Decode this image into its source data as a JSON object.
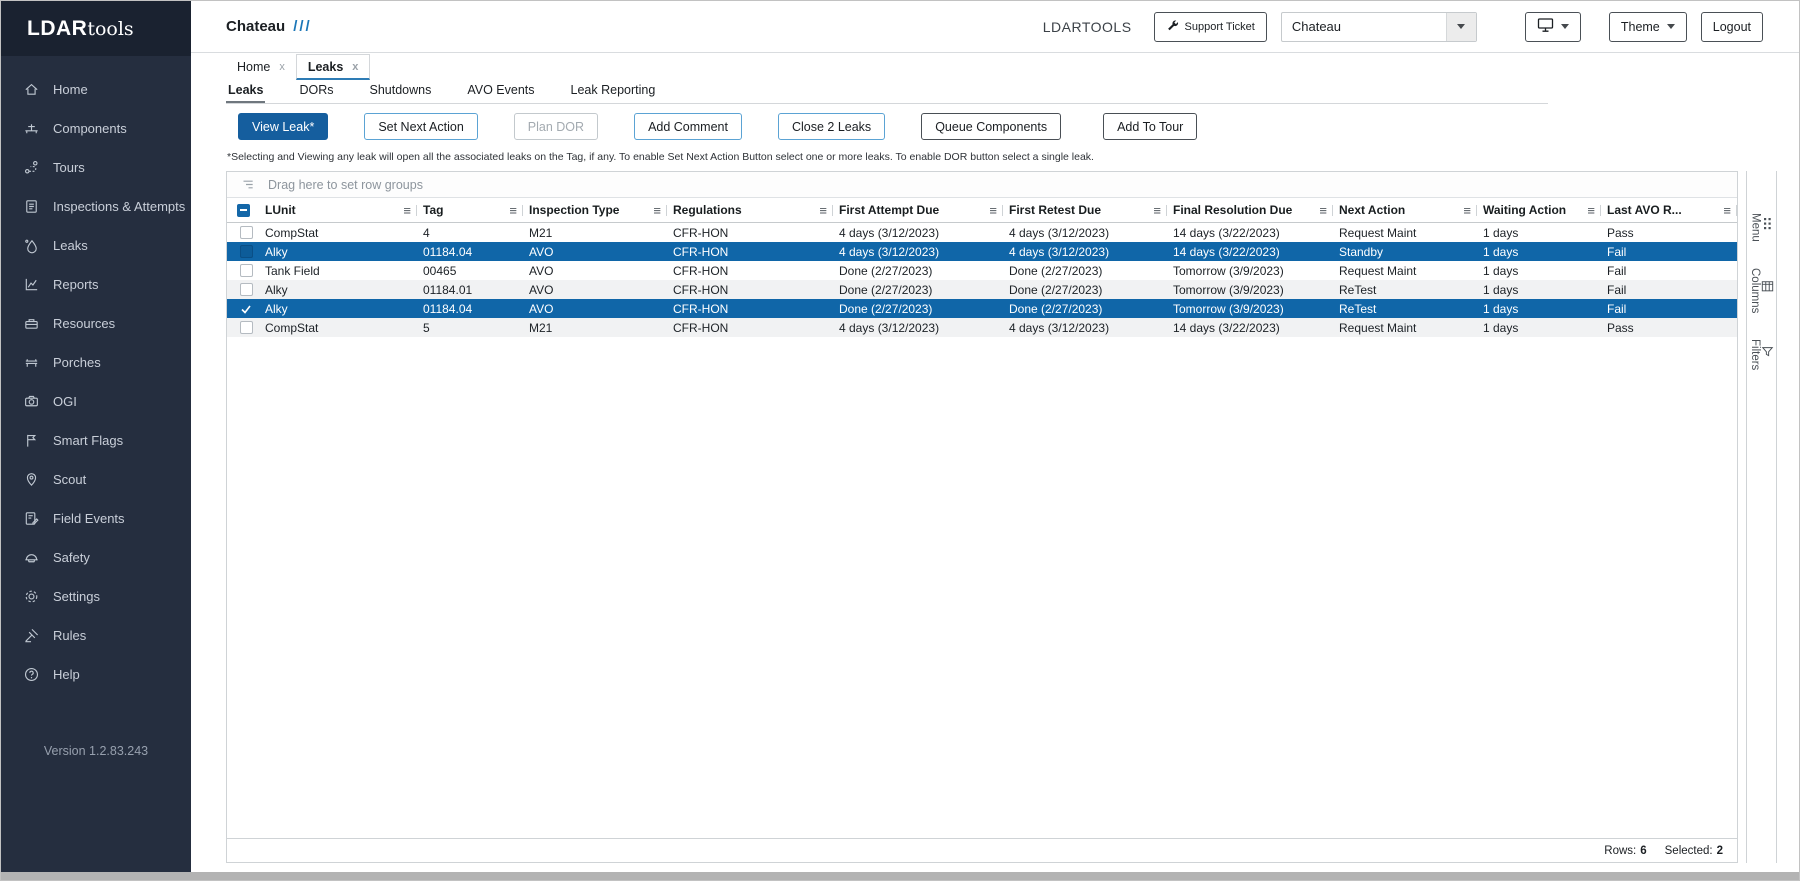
{
  "colors": {
    "accent_blue": "#1066a8",
    "primary_button_blue": "#155e9e",
    "sidebar_bg": "#252e3f",
    "sidebar_logo_bg": "#1a2230",
    "selected_row_blue": "#1066a8",
    "tab_underline_blue": "#2e7cb5"
  },
  "sidebar": {
    "logo": {
      "bold": "LDAR",
      "light": "tools"
    },
    "version": "Version 1.2.83.243",
    "items": [
      {
        "label": "Home",
        "icon": "home-icon"
      },
      {
        "label": "Components",
        "icon": "valve-icon"
      },
      {
        "label": "Tours",
        "icon": "route-icon"
      },
      {
        "label": "Inspections & Attempts",
        "icon": "clipboard-icon"
      },
      {
        "label": "Leaks",
        "icon": "droplet-icon"
      },
      {
        "label": "Reports",
        "icon": "chart-icon"
      },
      {
        "label": "Resources",
        "icon": "toolbox-icon"
      },
      {
        "label": "Porches",
        "icon": "bench-icon"
      },
      {
        "label": "OGI",
        "icon": "camera-icon"
      },
      {
        "label": "Smart Flags",
        "icon": "flag-icon"
      },
      {
        "label": "Scout",
        "icon": "map-pin-icon"
      },
      {
        "label": "Field Events",
        "icon": "clipboard-pen-icon"
      },
      {
        "label": "Safety",
        "icon": "helmet-icon"
      },
      {
        "label": "Settings",
        "icon": "gear-icon"
      },
      {
        "label": "Rules",
        "icon": "gavel-icon"
      },
      {
        "label": "Help",
        "icon": "question-icon"
      }
    ]
  },
  "header": {
    "title": "Chateau",
    "slashes": "///",
    "brand": "LDARTOOLS",
    "support_ticket": "Support Ticket",
    "site_selector_value": "Chateau",
    "theme": "Theme",
    "logout": "Logout"
  },
  "tabs": {
    "items": [
      {
        "label": "Home",
        "close": "x",
        "active": false
      },
      {
        "label": "Leaks",
        "close": "x",
        "active": true
      }
    ]
  },
  "subtabs": {
    "items": [
      "Leaks",
      "DORs",
      "Shutdowns",
      "AVO Events",
      "Leak Reporting"
    ]
  },
  "toolbar": {
    "view_leak": "View Leak*",
    "set_next_action": "Set Next Action",
    "plan_dor": "Plan DOR",
    "add_comment": "Add Comment",
    "close_leaks": "Close 2 Leaks",
    "queue_components": "Queue Components",
    "add_to_tour": "Add To Tour"
  },
  "note": "*Selecting and Viewing any leak will open all the associated leaks on the Tag, if any.  To enable Set Next Action Button select one or more leaks. To enable DOR button select a single leak.",
  "grid": {
    "row_group_hint": "Drag here to set row groups",
    "columns": [
      "LUnit",
      "Tag",
      "Inspection Type",
      "Regulations",
      "First Attempt Due",
      "First Retest Due",
      "Final Resolution Due",
      "Next Action",
      "Waiting Action",
      "Last AVO R...",
      "menu_glyph"
    ],
    "menu_glyph": "≡",
    "rows": [
      {
        "lunit": "CompStat",
        "tag": "4",
        "inspection_type": "M21",
        "regulations": "CFR-HON",
        "first_attempt_due": "4 days (3/12/2023)",
        "first_retest_due": "4 days (3/12/2023)",
        "final_resolution_due": "14 days (3/22/2023)",
        "next_action": "Request Maint",
        "waiting_action": "1 days",
        "last_avo_result": "Pass",
        "selected": false,
        "checkbox": "unchecked"
      },
      {
        "lunit": "Alky",
        "tag": "01184.04",
        "inspection_type": "AVO",
        "regulations": "CFR-HON",
        "first_attempt_due": "4 days (3/12/2023)",
        "first_retest_due": "4 days (3/12/2023)",
        "final_resolution_due": "14 days (3/22/2023)",
        "next_action": "Standby",
        "waiting_action": "1 days",
        "last_avo_result": "Fail",
        "selected": true,
        "checkbox": "filled"
      },
      {
        "lunit": "Tank Field",
        "tag": "00465",
        "inspection_type": "AVO",
        "regulations": "CFR-HON",
        "first_attempt_due": "Done (2/27/2023)",
        "first_retest_due": "Done (2/27/2023)",
        "final_resolution_due": "Tomorrow (3/9/2023)",
        "next_action": "Request Maint",
        "waiting_action": "1 days",
        "last_avo_result": "Fail",
        "selected": false,
        "checkbox": "unchecked"
      },
      {
        "lunit": "Alky",
        "tag": "01184.01",
        "inspection_type": "AVO",
        "regulations": "CFR-HON",
        "first_attempt_due": "Done (2/27/2023)",
        "first_retest_due": "Done (2/27/2023)",
        "final_resolution_due": "Tomorrow (3/9/2023)",
        "next_action": "ReTest",
        "waiting_action": "1 days",
        "last_avo_result": "Fail",
        "selected": false,
        "checkbox": "unchecked"
      },
      {
        "lunit": "Alky",
        "tag": "01184.04",
        "inspection_type": "AVO",
        "regulations": "CFR-HON",
        "first_attempt_due": "Done (2/27/2023)",
        "first_retest_due": "Done (2/27/2023)",
        "final_resolution_due": "Tomorrow (3/9/2023)",
        "next_action": "ReTest",
        "waiting_action": "1 days",
        "last_avo_result": "Fail",
        "selected": true,
        "checkbox": "checked"
      },
      {
        "lunit": "CompStat",
        "tag": "5",
        "inspection_type": "M21",
        "regulations": "CFR-HON",
        "first_attempt_due": "4 days (3/12/2023)",
        "first_retest_due": "4 days (3/12/2023)",
        "final_resolution_due": "14 days (3/22/2023)",
        "next_action": "Request Maint",
        "waiting_action": "1 days",
        "last_avo_result": "Pass",
        "selected": false,
        "checkbox": "unchecked"
      }
    ],
    "status": {
      "rows_label": "Rows:",
      "rows_value": "6",
      "selected_label": "Selected:",
      "selected_value": "2"
    }
  },
  "side_panel": {
    "tabs": [
      {
        "label": "Menu",
        "icon": "menu-dots-icon"
      },
      {
        "label": "Columns",
        "icon": "columns-icon"
      },
      {
        "label": "Filters",
        "icon": "filter-icon"
      }
    ]
  }
}
